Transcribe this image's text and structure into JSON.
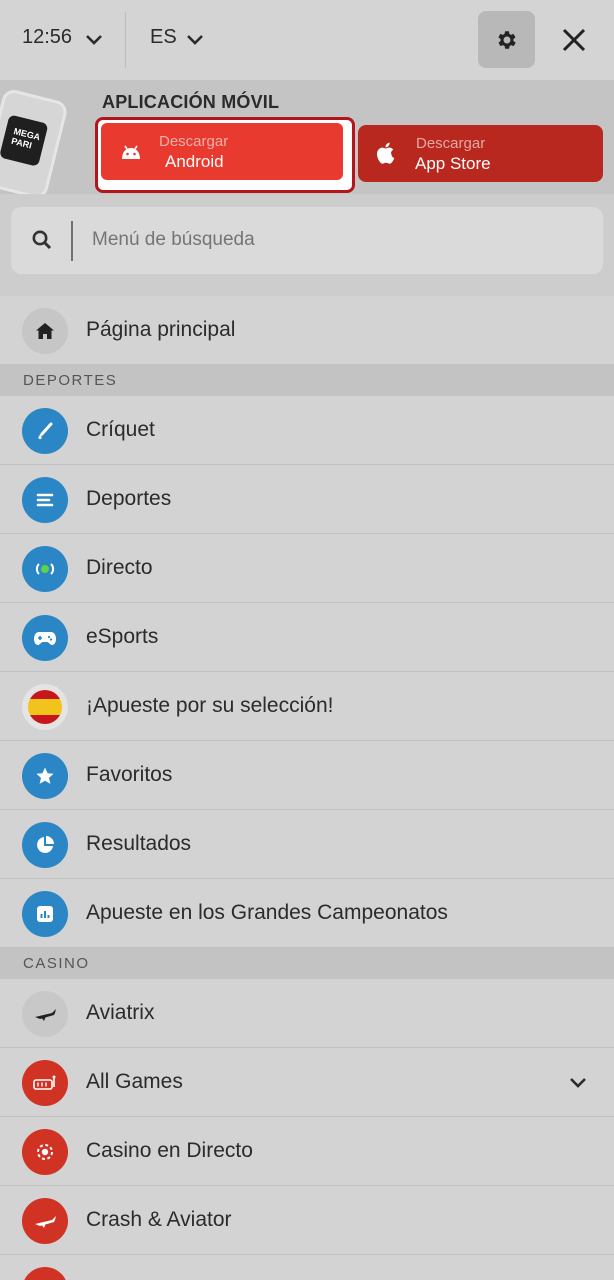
{
  "topbar": {
    "time": "12:56",
    "language": "ES"
  },
  "app_banner": {
    "title": "APLICACIÓN MÓVIL",
    "logo_text": "MEGA PARI",
    "android": {
      "small": "Descargar",
      "big": "Android"
    },
    "ios": {
      "small": "Descargar",
      "big": "App Store"
    }
  },
  "search": {
    "placeholder": "Menú de búsqueda"
  },
  "menu": {
    "home": {
      "label": "Página principal",
      "icon": "home-icon"
    },
    "sports_section": "DEPORTES",
    "sports": [
      {
        "label": "Críquet",
        "icon": "cricket-icon"
      },
      {
        "label": "Deportes",
        "icon": "list-icon"
      },
      {
        "label": "Directo",
        "icon": "live-icon"
      },
      {
        "label": "eSports",
        "icon": "gamepad-icon"
      },
      {
        "label": "¡Apueste por su selección!",
        "icon": "spain-flag-icon"
      },
      {
        "label": "Favoritos",
        "icon": "star-icon"
      },
      {
        "label": "Resultados",
        "icon": "pie-chart-icon"
      },
      {
        "label": "Apueste en los Grandes Campeonatos",
        "icon": "bar-chart-icon"
      }
    ],
    "casino_section": "CASINO",
    "casino": [
      {
        "label": "Aviatrix",
        "icon": "plane-icon"
      },
      {
        "label": "All Games",
        "icon": "slot-machine-icon"
      },
      {
        "label": "Casino en Directo",
        "icon": "chip-icon"
      },
      {
        "label": "Crash & Aviator",
        "icon": "plane-icon"
      }
    ]
  },
  "colors": {
    "accent_red": "#e83a2f",
    "icon_blue": "#2a86c4",
    "icon_red": "#d03224"
  }
}
